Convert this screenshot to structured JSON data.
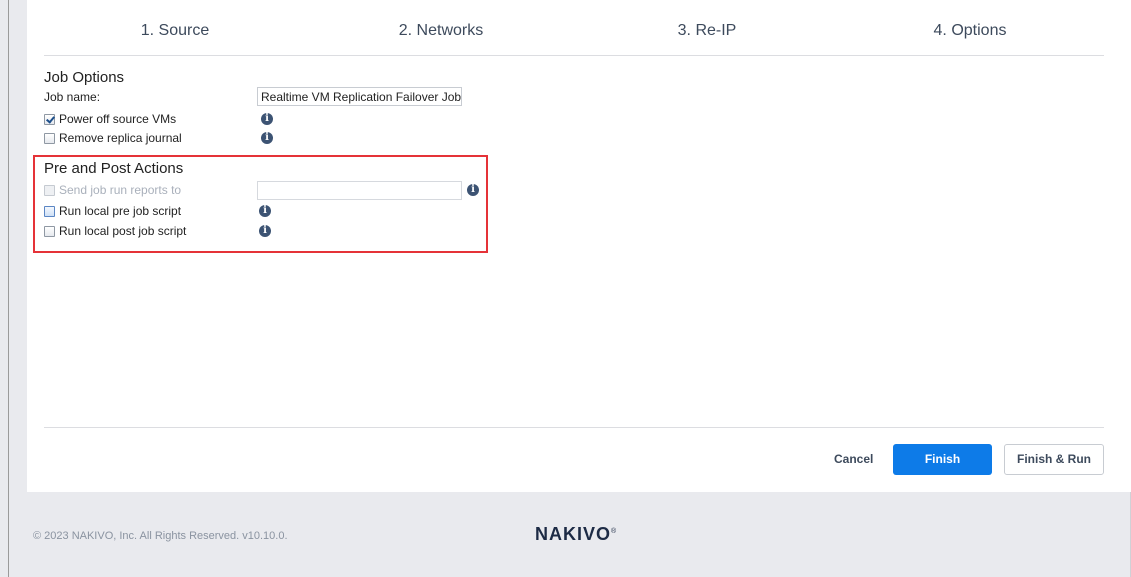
{
  "wizard": {
    "steps": [
      "1. Source",
      "2. Networks",
      "3. Re-IP",
      "4. Options"
    ]
  },
  "job_options": {
    "title": "Job Options",
    "job_name_label": "Job name:",
    "job_name_value": "Realtime VM Replication Failover Job",
    "power_off_label": "Power off source VMs",
    "power_off_checked": true,
    "remove_journal_label": "Remove replica journal",
    "remove_journal_checked": false
  },
  "pre_post": {
    "title": "Pre and Post Actions",
    "send_reports_label": "Send job run reports to",
    "send_reports_value": "",
    "pre_script_label": "Run local pre job script",
    "post_script_label": "Run local post job script"
  },
  "buttons": {
    "cancel": "Cancel",
    "finish": "Finish",
    "finish_run": "Finish & Run"
  },
  "footer": {
    "copyright": "© 2023 NAKIVO, Inc. All Rights Reserved. v10.10.0.",
    "logo": "NAKIVO"
  },
  "icons": {
    "info": "info-icon",
    "info_glyph": "i"
  },
  "colors": {
    "accent": "#0d7be8",
    "highlight_border": "#e53238",
    "info_icon": "#3c5373"
  }
}
